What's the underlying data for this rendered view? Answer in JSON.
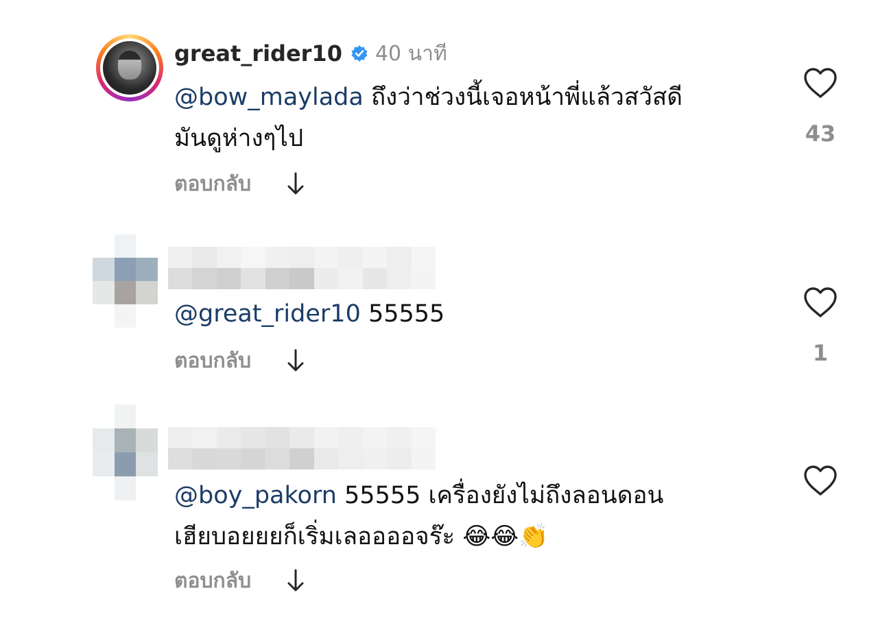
{
  "comments": [
    {
      "username": "great_rider10",
      "verified": true,
      "time": "40 นาที",
      "mention": "@bow_maylada",
      "text_line1": " ถึงว่าช่วงนี้เจอหน้าพี่แล้วสวัสดี",
      "text_line2": "มันดูห่างๆไป",
      "reply_label": "ตอบกลับ",
      "likes": "43"
    },
    {
      "username_hidden": true,
      "mention": "@great_rider10",
      "text_line1": " 55555",
      "reply_label": "ตอบกลับ",
      "likes": "1"
    },
    {
      "username_hidden": true,
      "mention": "@boy_pakorn",
      "text_line1": " 55555 เครื่องยังไม่ถึงลอนดอน",
      "text_line2": "เฮียบอยยยก็เริ่มเลออออจร๊ะ 😂😂👏",
      "reply_label": "ตอบกลับ",
      "likes": ""
    }
  ],
  "colors": {
    "mention": "#1b3c66",
    "muted": "#8e8e8e",
    "verified": "#3797f0"
  },
  "icons": [
    "heart-icon",
    "verified-badge-icon",
    "down-arrow-icon"
  ]
}
